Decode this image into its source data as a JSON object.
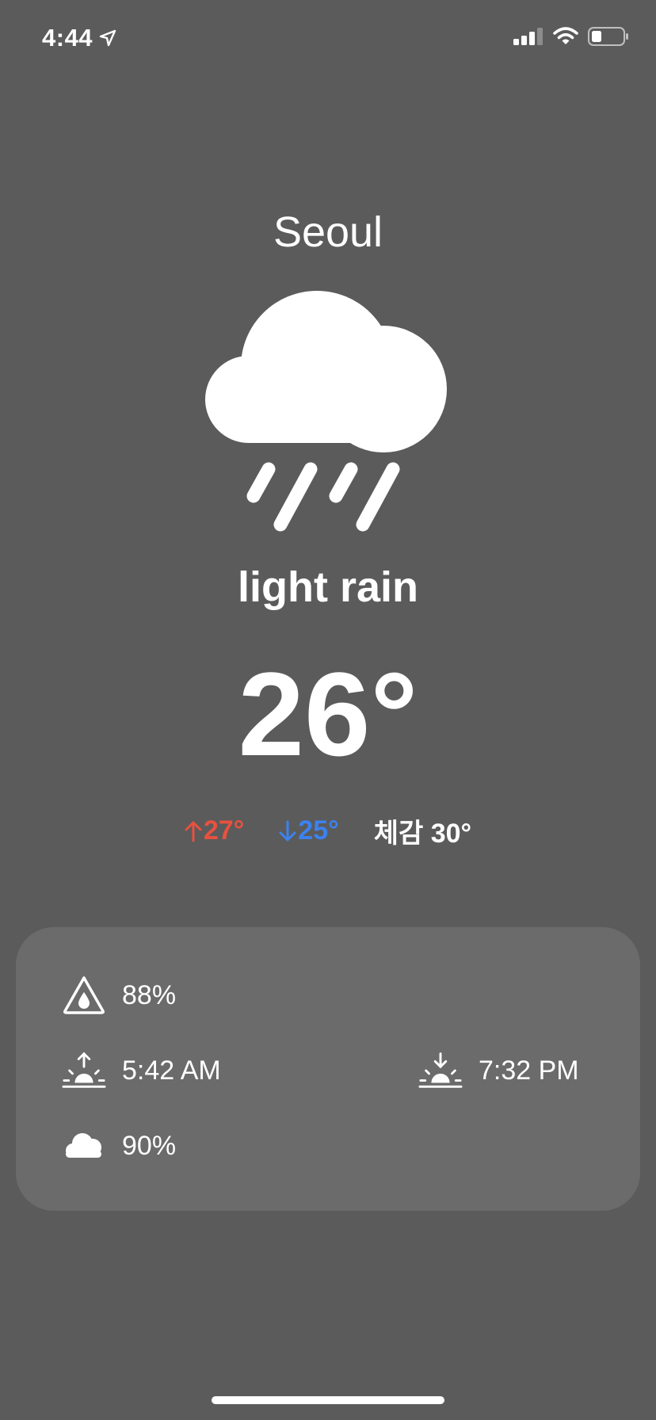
{
  "status_bar": {
    "time": "4:44",
    "icons": [
      "location-arrow-icon",
      "cellular-signal-icon",
      "wifi-icon",
      "battery-icon"
    ]
  },
  "weather": {
    "city": "Seoul",
    "condition": "light rain",
    "condition_icon": "cloud-rain-icon",
    "temperature": "26°",
    "high": "27°",
    "low": "25°",
    "feels_like": "체감 30°"
  },
  "details": {
    "humidity": {
      "icon": "humidity-drop-icon",
      "value": "88%"
    },
    "sunrise": {
      "icon": "sunrise-icon",
      "value": "5:42 AM"
    },
    "sunset": {
      "icon": "sunset-icon",
      "value": "7:32 PM"
    },
    "cloudiness": {
      "icon": "cloud-icon",
      "value": "90%"
    }
  },
  "colors": {
    "background": "#5b5b5b",
    "card": "#6b6b6b",
    "high_temp": "#e8513f",
    "low_temp": "#3c82f0"
  }
}
